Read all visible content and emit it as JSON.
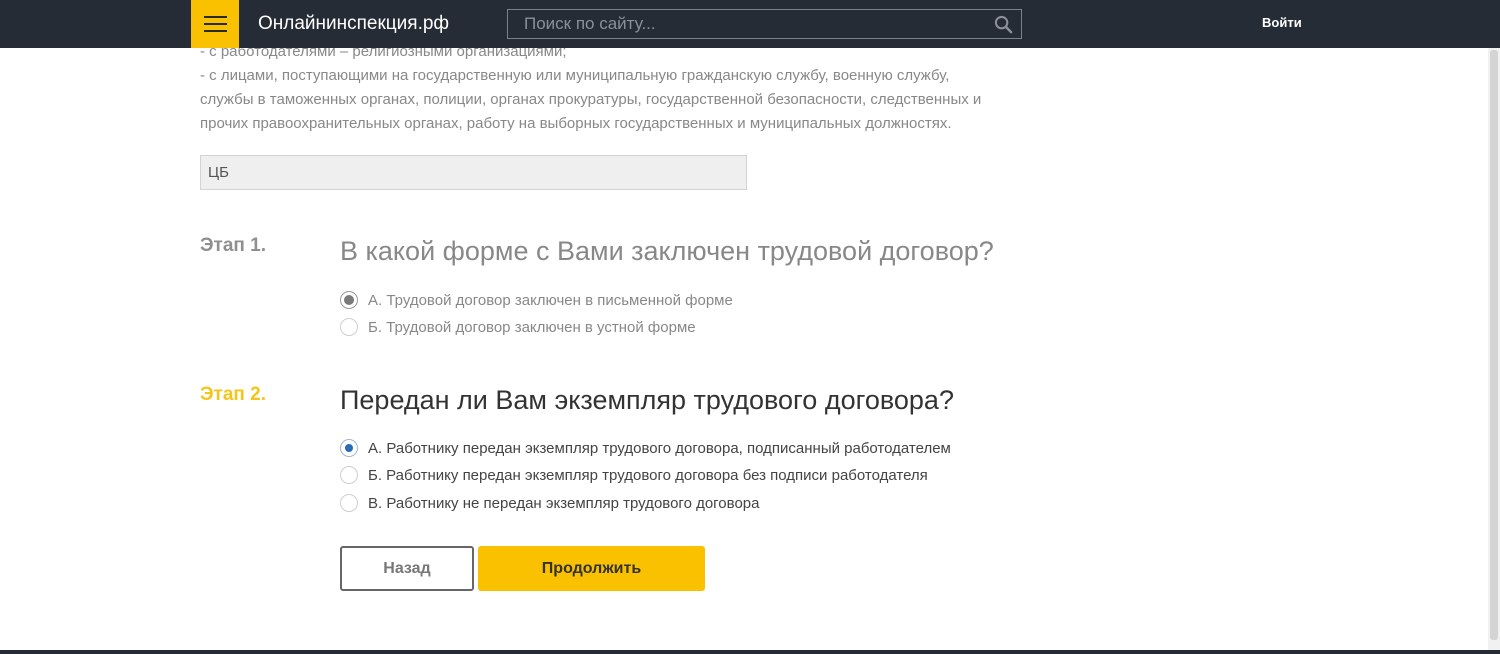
{
  "header": {
    "logo": "Онлайнинспекция.рф",
    "search_placeholder": "Поиск по сайту...",
    "login_label": "Войти"
  },
  "intro": {
    "lines": [
      "- с работодателями – религиозными организациями;",
      "- с лицами, поступающими на государственную или муниципальную гражданскую службу, военную службу,",
      "службы в таможенных органах, полиции, органах прокуратуры, государственной безопасности, следственных и",
      "прочих правоохранительных органах, работу на выборных государственных и муниципальных должностях."
    ],
    "field_value": "ЦБ"
  },
  "steps": [
    {
      "label": "Этап 1.",
      "question": "В какой форме с Вами заключен трудовой договор?",
      "options": [
        "А. Трудовой договор заключен в письменной форме",
        "Б. Трудовой договор заключен в устной форме"
      ],
      "selected_index": 0
    },
    {
      "label": "Этап 2.",
      "question": "Передан ли Вам экземпляр трудового договора?",
      "options": [
        "А. Работнику передан экземпляр трудового договора, подписанный работодателем",
        "Б. Работнику передан экземпляр трудового договора без подписи работодателя",
        "В. Работнику не передан экземпляр трудового договора"
      ],
      "selected_index": 0
    }
  ],
  "buttons": {
    "back": "Назад",
    "next": "Продолжить"
  },
  "colors": {
    "header_bg": "#262c36",
    "accent": "#f9c100",
    "step_active": "#f5c518",
    "radio_selected": "#2a6bb5"
  }
}
